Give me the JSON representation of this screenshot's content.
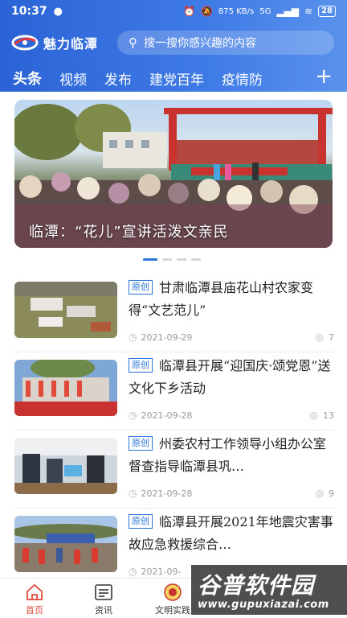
{
  "status_bar": {
    "time": "10:37",
    "speed": "875 KB/s",
    "network": "5G",
    "battery": "28"
  },
  "app": {
    "title": "魅力临潭",
    "search_placeholder": "搜一搜你感兴趣的内容"
  },
  "tabs": [
    {
      "label": "头条",
      "active": true
    },
    {
      "label": "视频",
      "active": false
    },
    {
      "label": "发布",
      "active": false
    },
    {
      "label": "建党百年",
      "active": false
    },
    {
      "label": "疫情防",
      "active": false
    }
  ],
  "tab_add_label": "+",
  "banner": {
    "caption": "临潭：“花儿”宣讲活泼文亲民",
    "slide_count": 4,
    "active_slide": 1
  },
  "news": [
    {
      "tag": "原创",
      "title": "甘肃临潭县庙花山村农家变得“文艺范儿”",
      "date": "2021-09-29",
      "views": "7"
    },
    {
      "tag": "原创",
      "title": "临潭县开展“迎国庆·颂党恩”送文化下乡活动",
      "date": "2021-09-28",
      "views": "13"
    },
    {
      "tag": "原创",
      "title": "州委农村工作领导小组办公室督查指导临潭县巩…",
      "date": "2021-09-28",
      "views": "9"
    },
    {
      "tag": "原创",
      "title": "临潭县开展2021年地震灾害事故应急救援综合…",
      "date": "2021-09-",
      "views": ""
    }
  ],
  "bottom_nav": [
    {
      "label": "首页",
      "icon": "home-icon",
      "active": true
    },
    {
      "label": "资讯",
      "icon": "news-icon",
      "active": false
    },
    {
      "label": "文明实践",
      "icon": "emblem-icon",
      "active": false
    }
  ],
  "watermark": {
    "title": "谷普软件园",
    "url": "www.gupuxiazai.com"
  },
  "colors": {
    "header_gradient_start": "#2b63d6",
    "accent": "#2b74d9",
    "nav_active": "#e04a3b"
  }
}
